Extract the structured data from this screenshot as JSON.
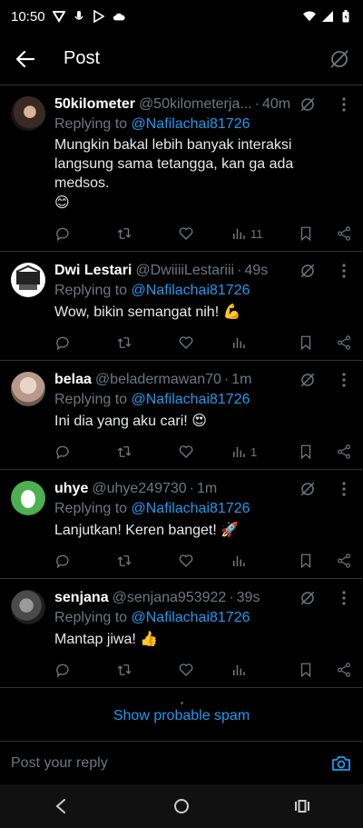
{
  "status_bar": {
    "time": "10:50",
    "icons": [
      "v-icon",
      "mic-icon",
      "play-store-icon",
      "cloud-icon",
      "wifi-icon",
      "signal-icon",
      "battery-icon"
    ]
  },
  "header": {
    "title": "Post",
    "back_icon": "arrow-left-icon",
    "grok_icon": "grok-icon"
  },
  "replies": [
    {
      "name": "50kilometer",
      "handle": "@50kilometerja...",
      "time": "40m",
      "replying_prefix": "Replying to",
      "mention": "@Nafilachai81726",
      "text": "Mungkin bakal lebih banyak interaksi langsung sama tetangga, kan ga ada medsos.",
      "emoji": "😊",
      "views": "11"
    },
    {
      "name": "Dwi Lestari",
      "handle": "@DwiiiiLestariii",
      "time": "49s",
      "replying_prefix": "Replying to",
      "mention": "@Nafilachai81726",
      "text": "Wow, bikin semangat nih!",
      "emoji": "💪",
      "views": ""
    },
    {
      "name": "belaa",
      "handle": "@beladermawan70",
      "time": "1m",
      "replying_prefix": "Replying to",
      "mention": "@Nafilachai81726",
      "text": "Ini dia yang aku cari!",
      "emoji": "😍",
      "views": "1"
    },
    {
      "name": "uhye",
      "handle": "@uhye249730",
      "time": "1m",
      "replying_prefix": "Replying to",
      "mention": "@Nafilachai81726",
      "text": "Lanjutkan! Keren banget!",
      "emoji": "🚀",
      "views": ""
    },
    {
      "name": "senjana",
      "handle": "@senjana953922",
      "time": "39s",
      "replying_prefix": "Replying to",
      "mention": "@Nafilachai81726",
      "text": "Mantap jiwa!",
      "emoji": "👍",
      "views": ""
    }
  ],
  "spam_link": "Show probable spam",
  "composer": {
    "placeholder": "Post your reply"
  },
  "nav": {
    "back": "nav-back-icon",
    "home": "nav-home-icon",
    "recents": "nav-recents-icon"
  },
  "colors": {
    "background": "#000000",
    "accent": "#1d9bf0",
    "muted": "#71767b",
    "divider": "#2f3336"
  }
}
